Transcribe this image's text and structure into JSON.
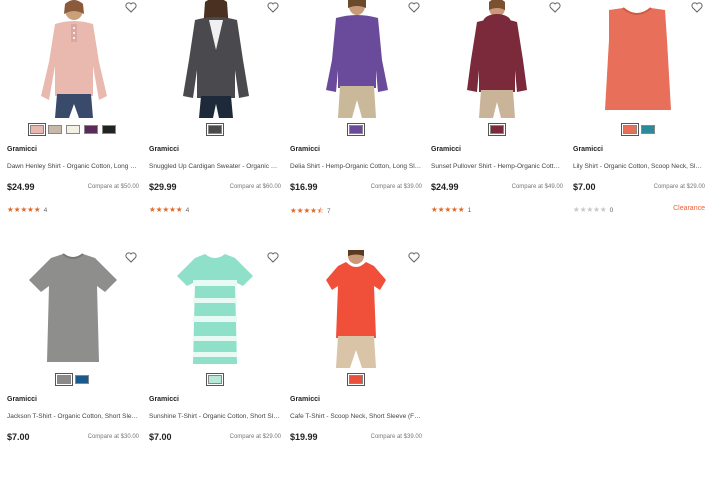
{
  "products": [
    {
      "brand": "Gramicci",
      "name": "Dawn Henley Shirt - Organic Cotton, Long Sleeve (For Women)",
      "price": "$24.99",
      "compare": "Compare at $50.00",
      "stars": "★★★★★",
      "rating_value": 5,
      "review_count": "4",
      "badge": "",
      "swatches": [
        "#e8b8b0",
        "#c8b8a8",
        "#f4f0e6",
        "#5a2a5a",
        "#222222"
      ],
      "selected_swatch": 0
    },
    {
      "brand": "Gramicci",
      "name": "Snuggled Up Cardigan Sweater - Organic Cotton (For Women)",
      "price": "$29.99",
      "compare": "Compare at $60.00",
      "stars": "★★★★★",
      "rating_value": 5,
      "review_count": "4",
      "badge": "",
      "swatches": [
        "#4a4a4a"
      ],
      "selected_swatch": 0
    },
    {
      "brand": "Gramicci",
      "name": "Delia Shirt - Hemp-Organic Cotton, Long Sleeve (For Women)",
      "price": "$16.99",
      "compare": "Compare at $39.00",
      "stars": "★★★★⯪",
      "rating_value": 4.5,
      "review_count": "7",
      "badge": "",
      "swatches": [
        "#6a4a9a"
      ],
      "selected_swatch": 0
    },
    {
      "brand": "Gramicci",
      "name": "Sunset Pullover Shirt - Hemp-Organic Cotton, Long Sleeve (For Women)",
      "price": "$24.99",
      "compare": "Compare at $49.00",
      "stars": "★★★★★",
      "rating_value": 5,
      "review_count": "1",
      "badge": "",
      "swatches": [
        "#7a2a3a"
      ],
      "selected_swatch": 0
    },
    {
      "brand": "Gramicci",
      "name": "Lily Shirt - Organic Cotton, Scoop Neck, Sleeveless (For Women)",
      "price": "$7.00",
      "compare": "Compare at $29.00",
      "stars": "★★★★★",
      "rating_value": 0,
      "review_count": "0",
      "badge": "Clearance",
      "swatches": [
        "#e8705a",
        "#2a8a9a"
      ],
      "selected_swatch": 0
    },
    {
      "brand": "Gramicci",
      "name": "Jackson T-Shirt - Organic Cotton, Short Sleeve (For Women)",
      "price": "$7.00",
      "compare": "Compare at $30.00",
      "stars": "",
      "rating_value": null,
      "review_count": "",
      "badge": "",
      "swatches": [
        "#8a8a88",
        "#1a5a8a"
      ],
      "selected_swatch": 0
    },
    {
      "brand": "Gramicci",
      "name": "Sunshine T-Shirt - Organic Cotton, Short Sleeve (For Women)",
      "price": "$7.00",
      "compare": "Compare at $29.00",
      "stars": "",
      "rating_value": null,
      "review_count": "",
      "badge": "",
      "swatches": [
        "#b8e8d8"
      ],
      "selected_swatch": 0
    },
    {
      "brand": "Gramicci",
      "name": "Cafe T-Shirt - Scoop Neck, Short Sleeve (For Women)",
      "price": "$19.99",
      "compare": "Compare at $39.00",
      "stars": "",
      "rating_value": null,
      "review_count": "",
      "badge": "",
      "swatches": [
        "#e8503a"
      ],
      "selected_swatch": 0
    }
  ],
  "colors": {
    "star": "#e06a2a",
    "star_empty": "#c8c8c8",
    "clearance": "#e8643a"
  },
  "icons": {
    "wishlist": "heart-outline-icon"
  }
}
